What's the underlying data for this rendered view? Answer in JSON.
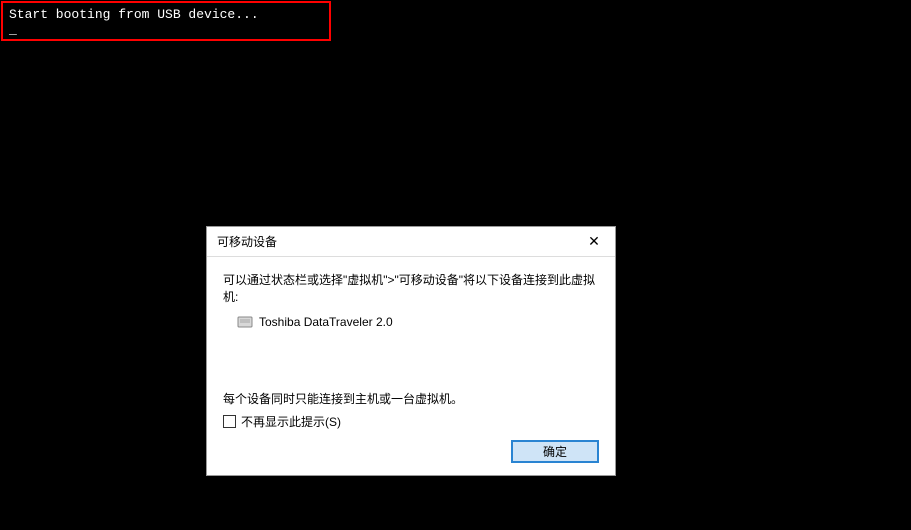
{
  "boot": {
    "message": "Start booting from USB device...",
    "cursor": "_"
  },
  "dialog": {
    "title": "可移动设备",
    "close_symbol": "✕",
    "instruction": "可以通过状态栏或选择\"虚拟机\">\"可移动设备\"将以下设备连接到此虚拟机:",
    "device": {
      "name": "Toshiba DataTraveler 2.0"
    },
    "note": "每个设备同时只能连接到主机或一台虚拟机。",
    "checkbox_label": "不再显示此提示(S)",
    "ok_label": "确定"
  }
}
